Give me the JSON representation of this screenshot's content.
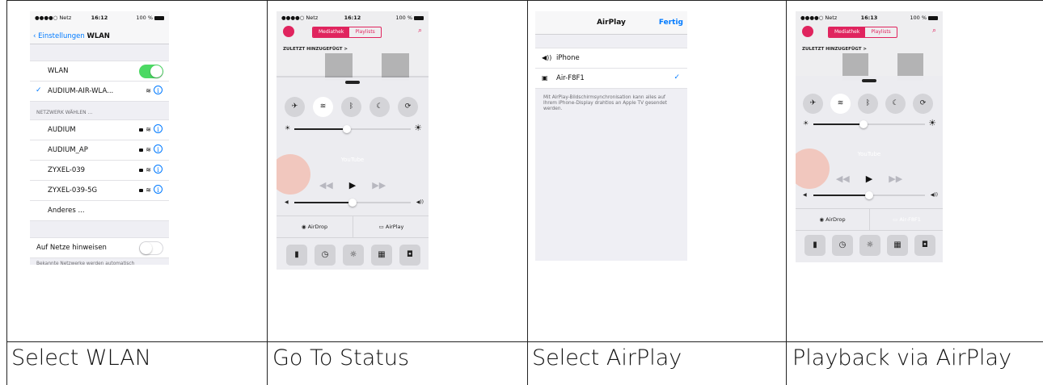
{
  "captions": [
    "Select WLAN",
    "Go To Status",
    "Select AirPlay",
    "Playback via AirPlay"
  ],
  "status": {
    "carrier": "●●●●○ Netz",
    "time1": "16:12",
    "time2": "16:12",
    "time4": "16:13",
    "battery": "100 %"
  },
  "wlan": {
    "back_label": "Einstellungen",
    "title": "WLAN",
    "toggle_label": "WLAN",
    "connected_network": "AUDIUM-AIR-WLA...",
    "section_label": "NETZWERK WÄHLEN ...",
    "networks": [
      "AUDIUM",
      "AUDIUM_AP",
      "ZYXEL-039",
      "ZYXEL-039-5G"
    ],
    "other_label": "Anderes ...",
    "ask_label": "Auf Netze hinweisen",
    "footer": "Bekannte Netzwerke werden automatisch"
  },
  "music": {
    "tab_library": "Mediathek",
    "tab_playlists": "Playlists",
    "recent_label": "ZULETZT HINZUGEFÜGT >"
  },
  "control_center": {
    "now_playing": "YouTube",
    "airdrop_label": "AirDrop",
    "airplay_label": "AirPlay",
    "airplay_active_label": "Air-F8F1",
    "brightness": 0.45,
    "volume": 0.5
  },
  "airplay": {
    "title": "AirPlay",
    "done_label": "Fertig",
    "devices": [
      "iPhone",
      "Air-F8F1"
    ],
    "note": "Mit AirPlay-Bildschirmsynchronisation kann alles auf Ihrem iPhone-Display drahtlos an Apple TV gesendet werden."
  }
}
